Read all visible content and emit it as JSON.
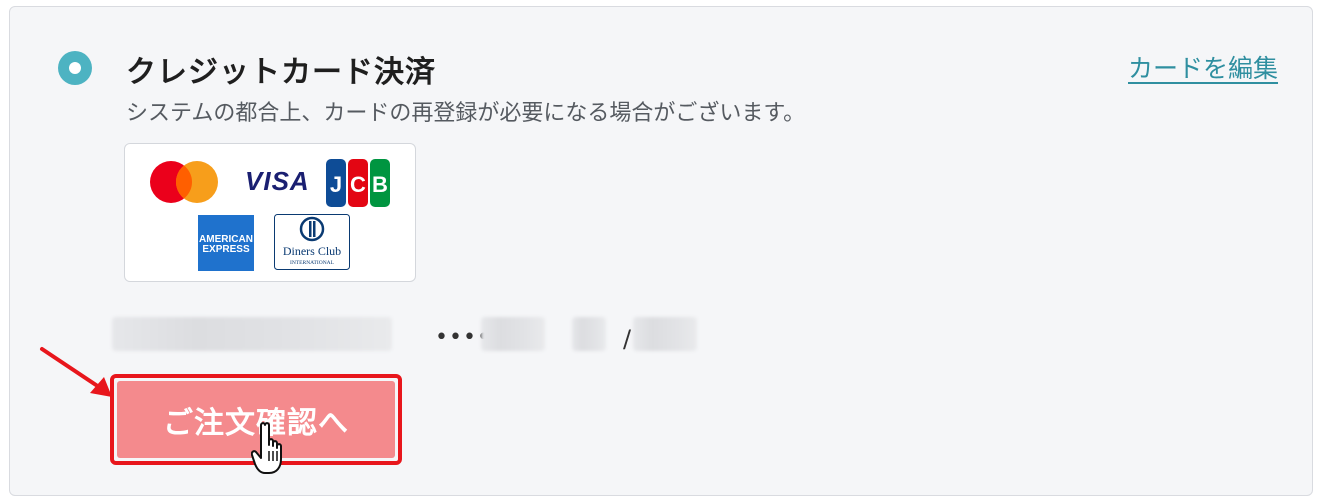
{
  "payment": {
    "title": "クレジットカード決済",
    "edit_link": "カードを編集",
    "note": "システムの都合上、カードの再登録が必要になる場合がございます。",
    "brands": {
      "visa": "VISA",
      "jcb_letters": [
        "J",
        "C",
        "B"
      ],
      "amex_line1": "AMERICAN",
      "amex_line2": "EXPRESS",
      "diners_line1": "Diners Club",
      "diners_line2": "INTERNATIONAL"
    },
    "card_number_dots": "••••",
    "expiry_separator": "/"
  },
  "order_button": {
    "label": "ご注文確認へ"
  },
  "colors": {
    "accent_teal": "#4db3c2",
    "link_teal": "#2f8fa0",
    "button_fill": "#f48a8d",
    "highlight_red": "#e8161c"
  },
  "icons": [
    "radio-selected-icon",
    "mastercard-logo",
    "visa-logo",
    "jcb-logo",
    "amex-logo",
    "diners-club-logo",
    "annotation-arrow-icon",
    "hand-pointer-cursor-icon"
  ]
}
